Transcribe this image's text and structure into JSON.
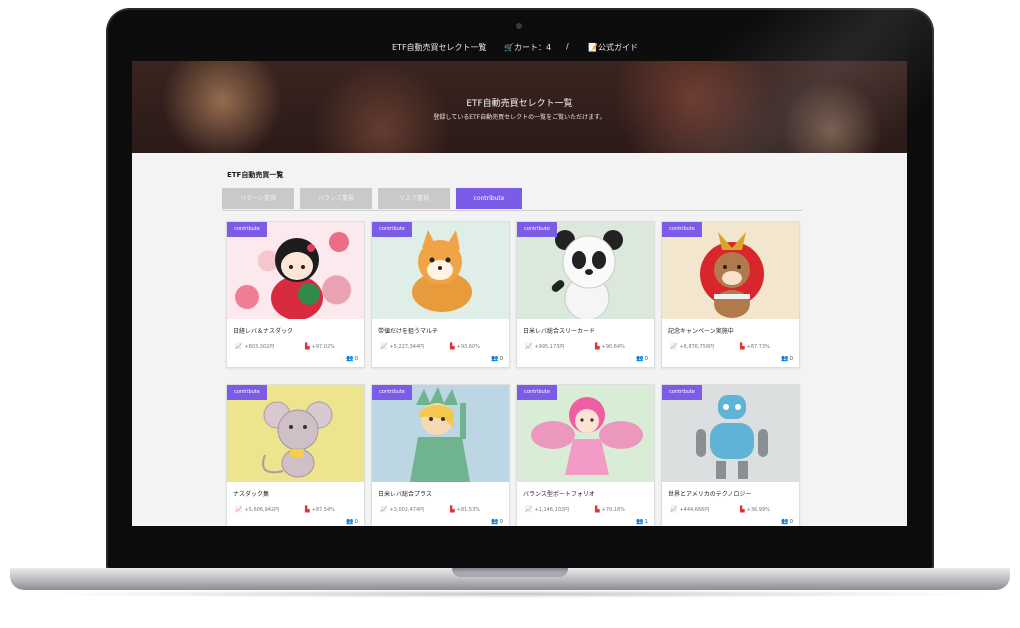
{
  "nav": {
    "items": [
      "ETF自動売買セレクト一覧",
      "🛒カート：4",
      "/",
      "📝公式ガイド"
    ]
  },
  "hero": {
    "title": "ETF自動売買セレクト一覧",
    "subtitle": "登録しているETF自動売買セレクトの一覧をご覧いただけます。"
  },
  "section": {
    "title": "ETF自動売買一覧"
  },
  "tabs": [
    "リターン重視",
    "バランス重視",
    "リスク重視",
    "contribute"
  ],
  "cards": [
    {
      "badge": "contribute",
      "title": "日経レバ＆ナスダック",
      "amount": "+803,302円",
      "pct": "+97.02%",
      "likes": "0"
    },
    {
      "badge": "contribute",
      "title": "带値だけを狙うマルチ",
      "amount": "+5,227,344円",
      "pct": "+93.60%",
      "likes": "0"
    },
    {
      "badge": "contribute",
      "title": "日米レバ総合スリーカード",
      "amount": "+995,173円",
      "pct": "+90.64%",
      "likes": "0"
    },
    {
      "badge": "contribute",
      "title": "記念キャンペーン実施中",
      "amount": "+6,876,756円",
      "pct": "+87.73%",
      "likes": "0"
    },
    {
      "badge": "contribute",
      "title": "ナスダック集",
      "amount": "+5,606,942円",
      "pct": "+87.54%",
      "likes": "0"
    },
    {
      "badge": "contribute",
      "title": "日米レバ総合プラス",
      "amount": "+3,002,474円",
      "pct": "+81.53%",
      "likes": "0"
    },
    {
      "badge": "contribute",
      "title": "バランス型ポートフォリオ",
      "amount": "+1,146,102円",
      "pct": "+70.16%",
      "likes": "1"
    },
    {
      "badge": "contribute",
      "title": "世界とアメリカのテクノロジー",
      "amount": "+444,666円",
      "pct": "+36.99%",
      "likes": "0"
    }
  ],
  "colors": {
    "accent": "#7c5ce6",
    "up": "#2e9e58",
    "down": "#e0342f"
  }
}
